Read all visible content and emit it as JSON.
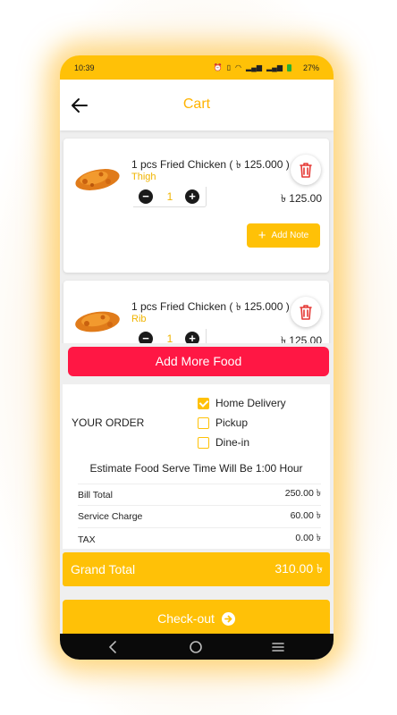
{
  "status_bar": {
    "time": "10:39",
    "battery": "27%",
    "icons": [
      "alarm-icon",
      "vibrate-icon",
      "wifi-icon",
      "signal-icon",
      "signal-icon",
      "battery-icon"
    ]
  },
  "header": {
    "title": "Cart",
    "back_icon": "arrow-left-icon"
  },
  "cart_items": [
    {
      "name": "1 pcs Fried Chicken ( ৳ 125.000 )",
      "variant": "Thigh",
      "quantity": "1",
      "price": "৳ 125.00",
      "add_note_label": "Add Note"
    },
    {
      "name": "1 pcs Fried Chicken ( ৳ 125.000 )",
      "variant": "Rib",
      "quantity": "1",
      "price": "৳ 125.00"
    }
  ],
  "add_more_label": "Add More Food",
  "order": {
    "title": "YOUR ORDER",
    "options": [
      {
        "label": "Home Delivery",
        "checked": true
      },
      {
        "label": "Pickup",
        "checked": false
      },
      {
        "label": "Dine-in",
        "checked": false
      }
    ],
    "estimate_text": "Estimate Food Serve Time Will Be 1:00 Hour"
  },
  "bill": [
    {
      "label": "Bill Total",
      "value": "250.00 ৳"
    },
    {
      "label": "Service Charge",
      "value": "60.00 ৳"
    },
    {
      "label": "TAX",
      "value": "0.00 ৳"
    }
  ],
  "grand_total": {
    "label": "Grand Total",
    "value": "310.00 ৳"
  },
  "checkout_label": "Check-out",
  "colors": {
    "accent": "#ffc107",
    "danger": "#ff1744",
    "variant_text": "#f0b400"
  }
}
